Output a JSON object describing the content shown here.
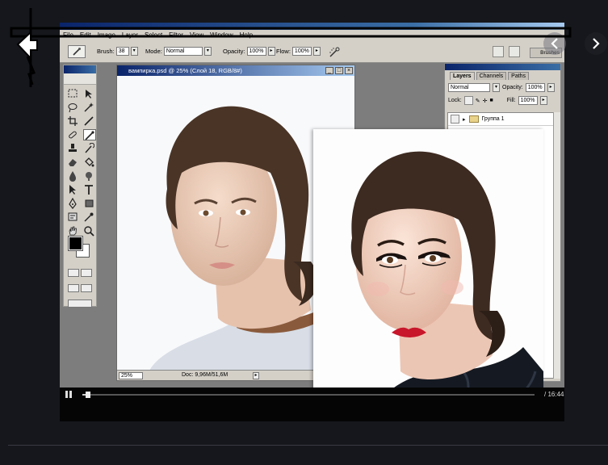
{
  "photoshop": {
    "menu": [
      "File",
      "Edit",
      "Image",
      "Layer",
      "Select",
      "Filter",
      "View",
      "Window",
      "Help"
    ],
    "options": {
      "brush_label": "Brush:",
      "brush_size": "38",
      "mode_label": "Mode:",
      "mode_value": "Normal",
      "opacity_label": "Opacity:",
      "opacity_value": "100%",
      "flow_label": "Flow:",
      "flow_value": "100%",
      "brushes_tab": "Brushes"
    },
    "document": {
      "title": "вампирка.psd @ 25% (Слой 18, RGB/8#)",
      "zoom": "25%",
      "doc_info": "Doc: 9,96M/51,6M"
    },
    "layers_panel": {
      "tabs": [
        "Layers",
        "Channels",
        "Paths"
      ],
      "blend_mode": "Normal",
      "opacity_label": "Opacity:",
      "opacity_value": "100%",
      "lock_label": "Lock:",
      "fill_label": "Fill:",
      "fill_value": "100%",
      "group_name": "Группа 1"
    }
  },
  "video": {
    "time": "/ 16:44",
    "progress": 0.01
  },
  "colors": {
    "background": "#16171c",
    "lip_red": "#c8162a"
  }
}
